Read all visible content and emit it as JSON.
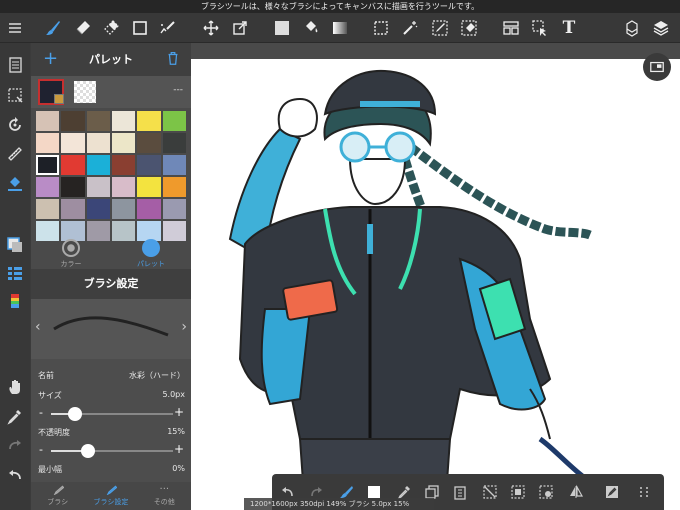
{
  "hint": "ブラシツールは、様々なブラシによってキャンバスに描画を行うツールです。",
  "toolbar": {
    "left_icons": [
      "menu-icon",
      "brush-icon",
      "eraser-icon",
      "dotted-eraser-icon",
      "rectangle-icon",
      "correction-brush-icon"
    ],
    "middle_icons": [
      "move-icon",
      "transform-icon",
      "fill-icon",
      "bucket-icon",
      "gradient-icon",
      "select-icon",
      "magic-wand-icon",
      "select-pen-icon",
      "select-eraser-icon"
    ],
    "right_icons": [
      "panel-layout-icon",
      "operation-icon",
      "text-icon",
      "material-icon",
      "layers-icon"
    ],
    "text_glyph": "T"
  },
  "sidebar": {
    "icons": [
      "page-icon",
      "selection-icon",
      "rotate-icon",
      "ruler-icon",
      "paint-icon",
      "color-icon",
      "layer-list-icon",
      "brush-color-icon",
      "hand-icon",
      "eyedropper-icon",
      "redo-icon",
      "undo-icon"
    ]
  },
  "palette": {
    "title": "パレット",
    "current_value": "---",
    "swatches": [
      "#d6c2b5",
      "#4d3f32",
      "#6b5d4a",
      "#ece6d8",
      "#f5e04a",
      "#7cc447",
      "#f4d7c6",
      "#f3e5d8",
      "#ede1d0",
      "#ece6c8",
      "#5a4c3e",
      "#3a3d3c",
      "#1d2027",
      "#e13a32",
      "#1bb0d8",
      "#8a3f31",
      "#4b5470",
      "#6f88b8",
      "#b98cc6",
      "#262322",
      "#c9c1c8",
      "#d8bcc9",
      "#f3e33f",
      "#ef9a2c",
      "#ccc0b0",
      "#9e8ea1",
      "#3b4678",
      "#8d959f",
      "#a55ea6",
      "#9a9ab0",
      "#cce2ea",
      "#b0c0d4",
      "#9f9aa6",
      "#b7c4c8",
      "#b6d6f2",
      "#d0ccd8"
    ],
    "tabs": [
      {
        "label": "カラー"
      },
      {
        "label": "パレット"
      }
    ]
  },
  "brush": {
    "title": "ブラシ設定",
    "name_label": "名前",
    "name_value": "水彩（ハード）",
    "size_label": "サイズ",
    "size_value": "5.0px",
    "size_level": 0.2,
    "opacity_label": "不透明度",
    "opacity_value": "15%",
    "opacity_level": 0.3,
    "min_width_label": "最小幅",
    "min_width_value": "0%",
    "minus": "-",
    "plus": "+",
    "prev": "‹",
    "next": "›",
    "tabs": [
      {
        "label": "ブラシ"
      },
      {
        "label": "ブラシ設定"
      },
      {
        "label": "その他"
      }
    ]
  },
  "status": "1200*1600px 350dpi 149% ブラシ 5.0px 15%",
  "bottom_toolbar": {
    "icons": [
      "undo-arrow-icon",
      "redo-arrow-icon",
      "brush-mode-icon",
      "color-swatch-icon",
      "eyedropper-icon",
      "copy-icon",
      "paste-icon",
      "clear-icon",
      "crop-icon",
      "snap-icon",
      "flip-icon",
      "edit-icon",
      "more-icon"
    ]
  }
}
